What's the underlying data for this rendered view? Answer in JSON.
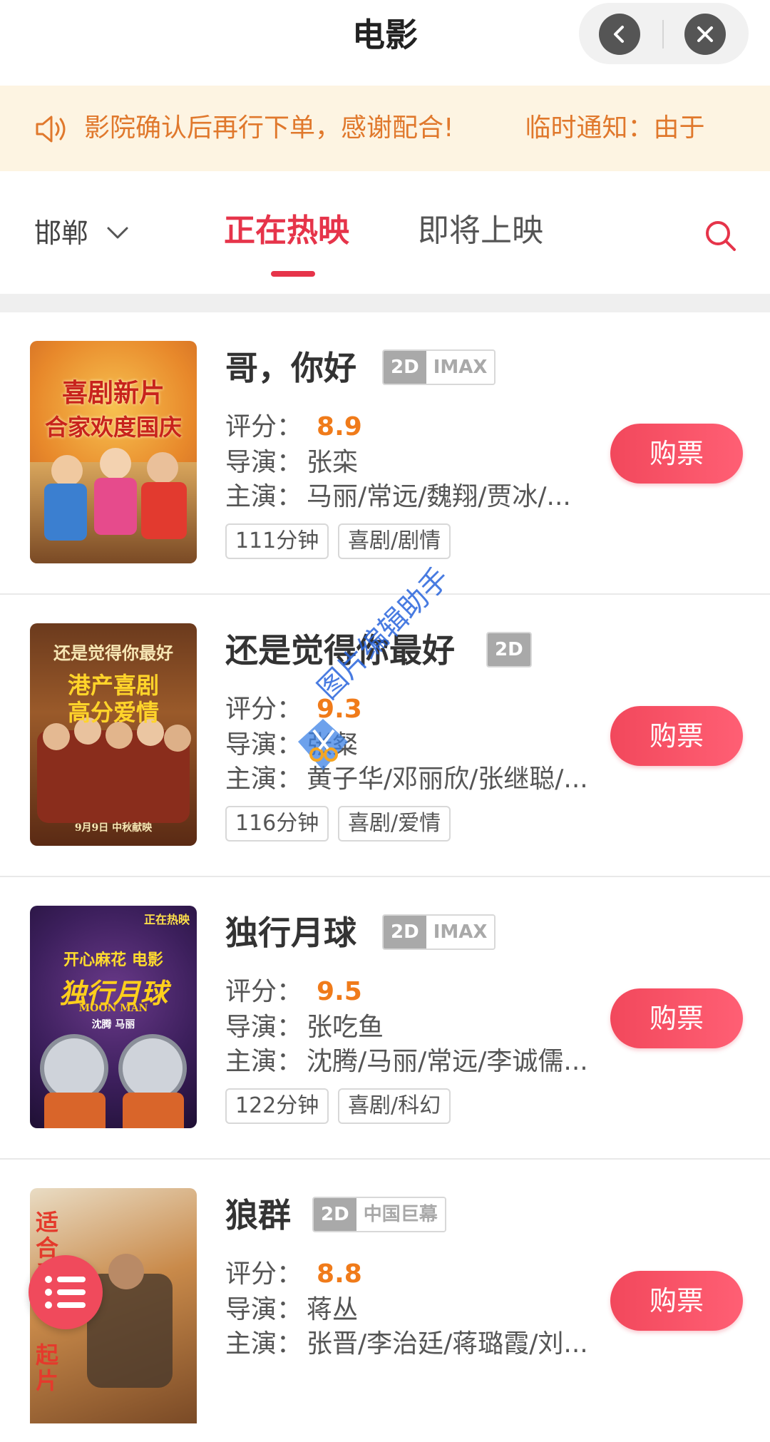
{
  "header": {
    "title": "电影"
  },
  "notice": {
    "icon": "speaker-icon",
    "text_part1": "影院确认后再行下单，感谢配合!",
    "text_part2": "临时通知：由于"
  },
  "tabbar": {
    "city": "邯郸",
    "tabs": [
      {
        "label": "正在热映",
        "active": true
      },
      {
        "label": "即将上映",
        "active": false
      }
    ]
  },
  "labels": {
    "score": "评分：",
    "director": "导演：",
    "cast": "主演：",
    "buy": "购票"
  },
  "movies": [
    {
      "title": "哥，你好",
      "format": [
        "2D",
        "IMAX"
      ],
      "score": "8.9",
      "director": "张栾",
      "cast": "马丽/常远/魏翔/贾冰/...",
      "duration": "111分钟",
      "genre": "喜剧/剧情",
      "poster_text": [
        "喜剧新片",
        "合家欢度国庆"
      ]
    },
    {
      "title": "还是觉得你最好",
      "format": [
        "2D"
      ],
      "score": "9.3",
      "director": "张粲",
      "cast": "黄子华/邓丽欣/张继聪/...",
      "duration": "116分钟",
      "genre": "喜剧/爱情",
      "poster_text": [
        "还是觉得你最好",
        "港产喜剧",
        "高分爱情",
        "9月9日 中秋献映"
      ]
    },
    {
      "title": "独行月球",
      "format": [
        "2D",
        "IMAX"
      ],
      "score": "9.5",
      "director": "张吃鱼",
      "cast": "沈腾/马丽/常远/李诚儒...",
      "duration": "122分钟",
      "genre": "喜剧/科幻",
      "poster_text": [
        "正在热映",
        "开心麻花 电影",
        "独行月球",
        "MOON MAN",
        "沈腾 马丽"
      ]
    },
    {
      "title": "狼群",
      "format": [
        "2D",
        "中国巨幕"
      ],
      "score": "8.8",
      "director": "蒋丛",
      "cast": "张晋/李治廷/蒋璐霞/刘...",
      "poster_text": [
        "适合看",
        "起片"
      ]
    }
  ],
  "watermark": "图片编辑助手",
  "colors": {
    "accent": "#e6344a",
    "score": "#f07b1a",
    "notice_bg": "#fdf4e2",
    "notice_text": "#e0782c"
  }
}
